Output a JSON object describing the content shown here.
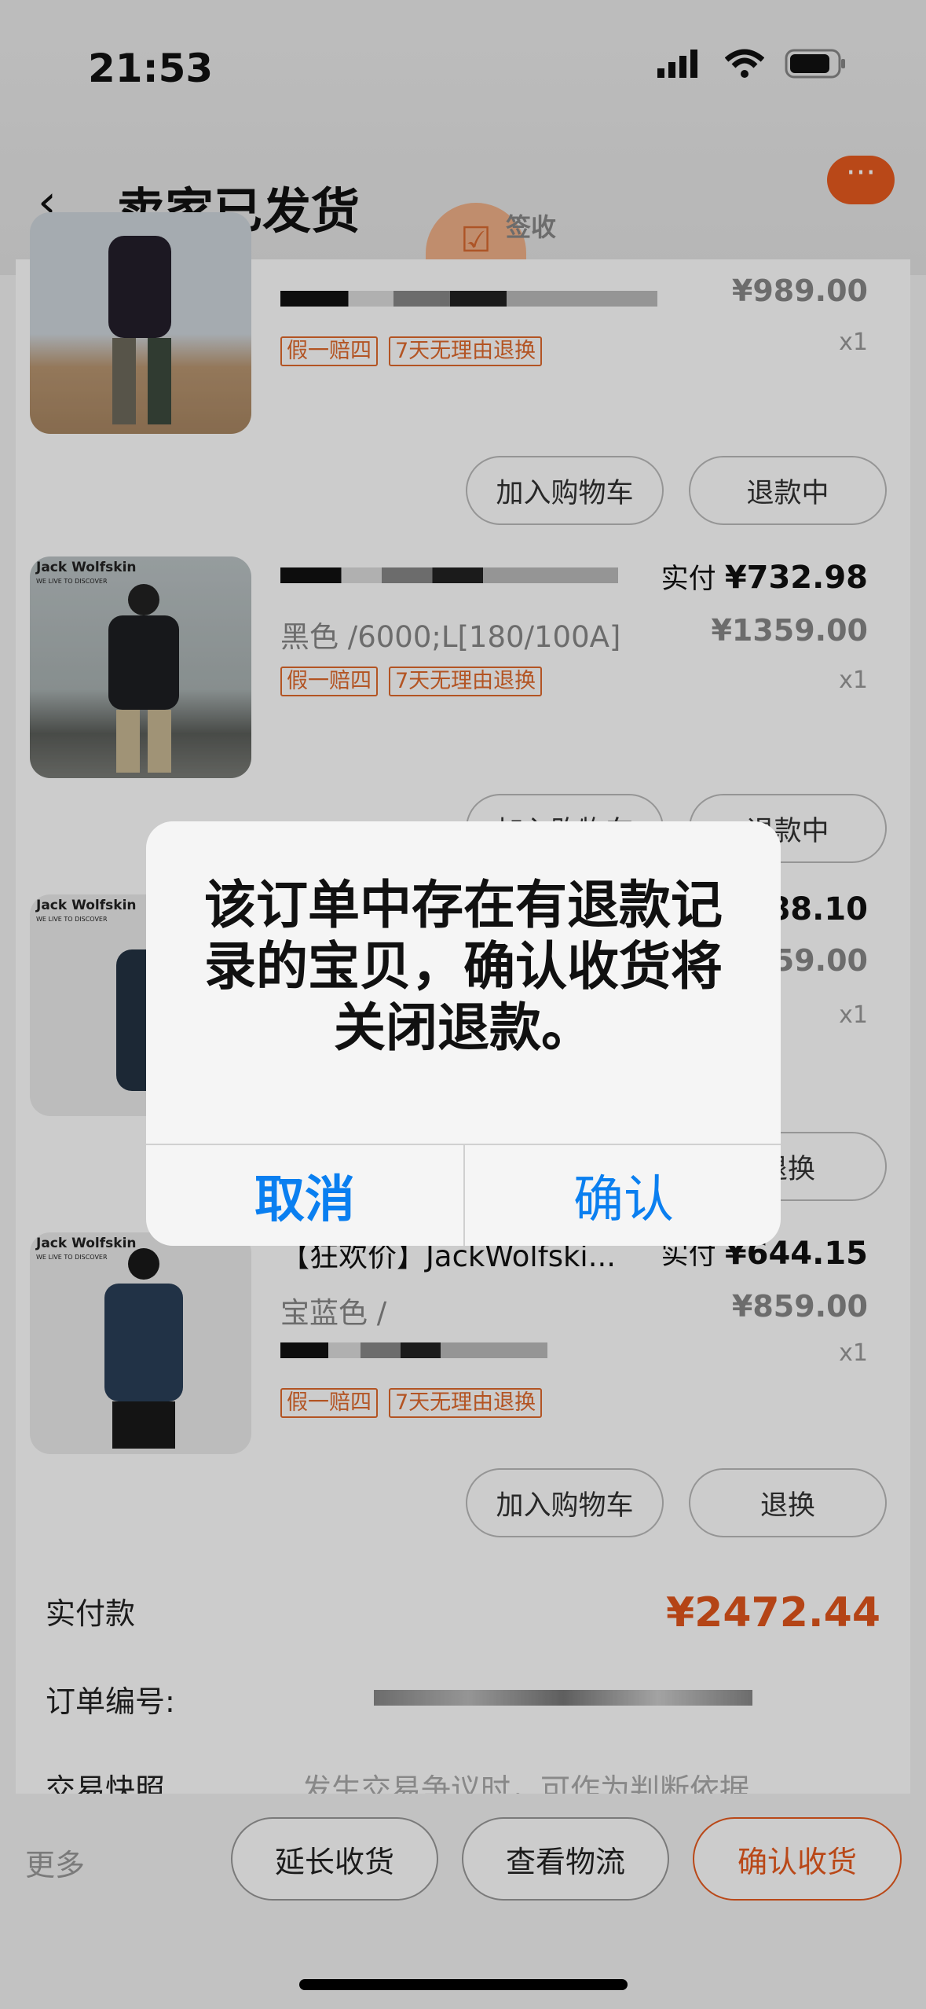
{
  "status_bar": {
    "time": "21:53"
  },
  "header": {
    "back_symbol": "‹",
    "title": "卖家已发货",
    "sign_label": "签收",
    "more_symbol": "···"
  },
  "items": [
    {
      "title": "",
      "spec": "",
      "tags": [
        "假一赔四",
        "7天无理由退换"
      ],
      "paid_label": "",
      "paid_amount": "",
      "original_price": "¥989.00",
      "qty": "x1",
      "buttons": [
        "加入购物车",
        "退款中"
      ]
    },
    {
      "title": "",
      "spec": "黑色 /6000;L[180/100A]",
      "tags": [
        "假一赔四",
        "7天无理由退换"
      ],
      "paid_label": "实付",
      "paid_amount": "¥732.98",
      "original_price": "¥1359.00",
      "qty": "x1",
      "buttons": [
        "加入购物车",
        "退款中"
      ]
    },
    {
      "title": "",
      "spec": "",
      "tags": [],
      "paid_label": "",
      "paid_amount": "¥588.10",
      "original_price": "¥1259.00",
      "qty": "x1",
      "buttons": [
        "",
        "退换"
      ]
    },
    {
      "title": "【狂欢价】JackWolfski...",
      "spec": "宝蓝色 /",
      "tags": [
        "假一赔四",
        "7天无理由退换"
      ],
      "paid_label": "实付",
      "paid_amount": "¥644.15",
      "original_price": "¥859.00",
      "qty": "x1",
      "buttons": [
        "加入购物车",
        "退换"
      ]
    }
  ],
  "brand_logo": {
    "line1": "Jack Wolfskin",
    "line2": "WE LIVE TO DISCOVER"
  },
  "summary": {
    "paid_label": "实付款",
    "paid_total": "¥2472.44",
    "order_no_label": "订单编号:",
    "snapshot_label": "交易快照",
    "snapshot_hint": "发生交易争议时，可作为判断依据"
  },
  "bottom": {
    "more": "更多",
    "extend": "延长收货",
    "logistics": "查看物流",
    "confirm": "确认收货"
  },
  "alert": {
    "message": "该订单中存在有退款记录的宝贝，确认收货将关闭退款。",
    "cancel": "取消",
    "confirm": "确认"
  },
  "colors": {
    "accent": "#e85a1e",
    "ios_blue": "#0a7ff0"
  }
}
